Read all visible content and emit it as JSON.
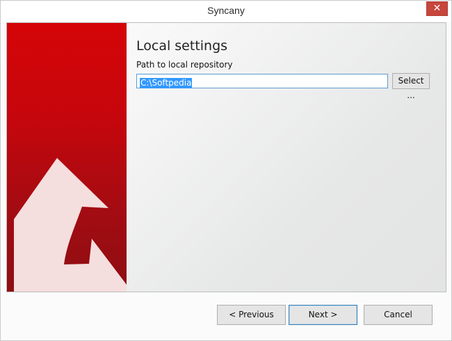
{
  "window": {
    "title": "Syncany",
    "close_label": "✕"
  },
  "page": {
    "heading": "Local settings",
    "path_label": "Path to local repository",
    "path_value": "C:\\Softpedia",
    "select_label": "Select ..."
  },
  "footer": {
    "previous_label": "< Previous",
    "next_label": "Next >",
    "cancel_label": "Cancel"
  },
  "colors": {
    "banner_red": "#c6060d",
    "selection_blue": "#3399ff"
  }
}
